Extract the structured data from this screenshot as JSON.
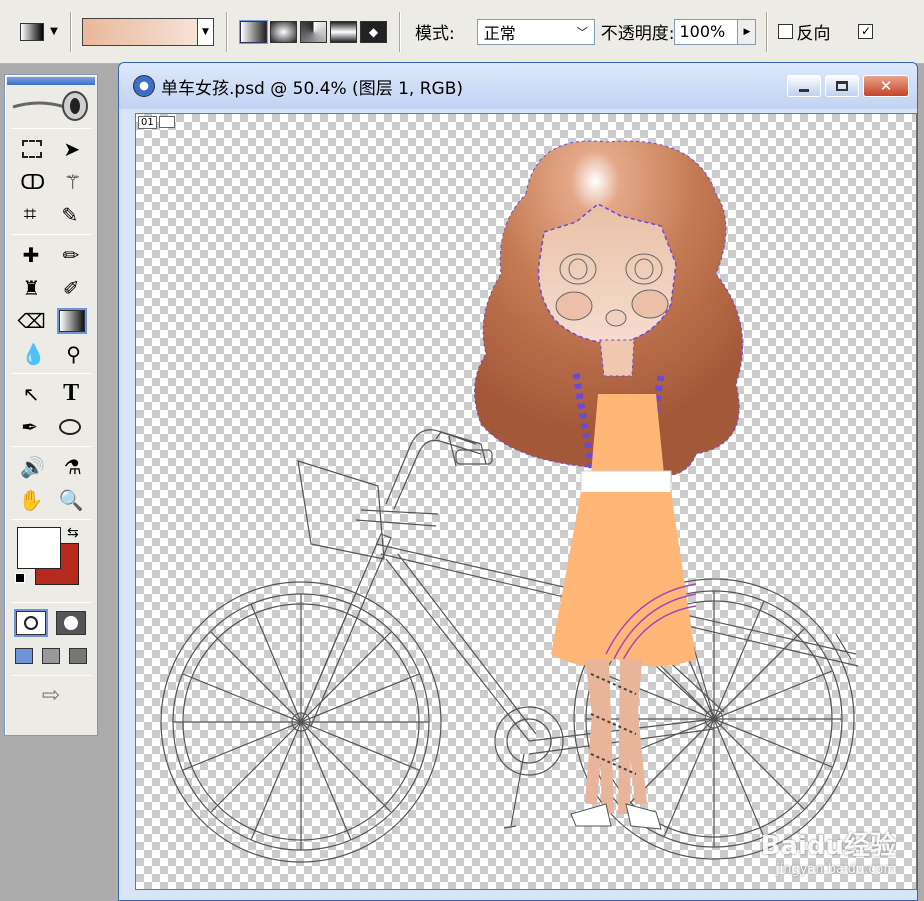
{
  "options": {
    "mode_label": "模式:",
    "mode_value": "正常",
    "opacity_label": "不透明度:",
    "opacity_value": "100%",
    "reverse_label": "反向",
    "gradient_colors": [
      "#eab79a",
      "#f9eae1"
    ]
  },
  "document": {
    "title": "单车女孩.psd @ 50.4% (图层 1, RGB)",
    "layer_badge": "01"
  },
  "colors": {
    "foreground": "#ffffff",
    "background": "#b52a1c",
    "hair_light": "#ce8a68",
    "hair_dark": "#a65b35",
    "skin": "#f0c8b0",
    "dress": "#ffb677",
    "selection": "#6a4ad8"
  },
  "watermark": {
    "brand": "Baidu",
    "suffix": "经验",
    "url": "jingyan.baidu.com"
  }
}
